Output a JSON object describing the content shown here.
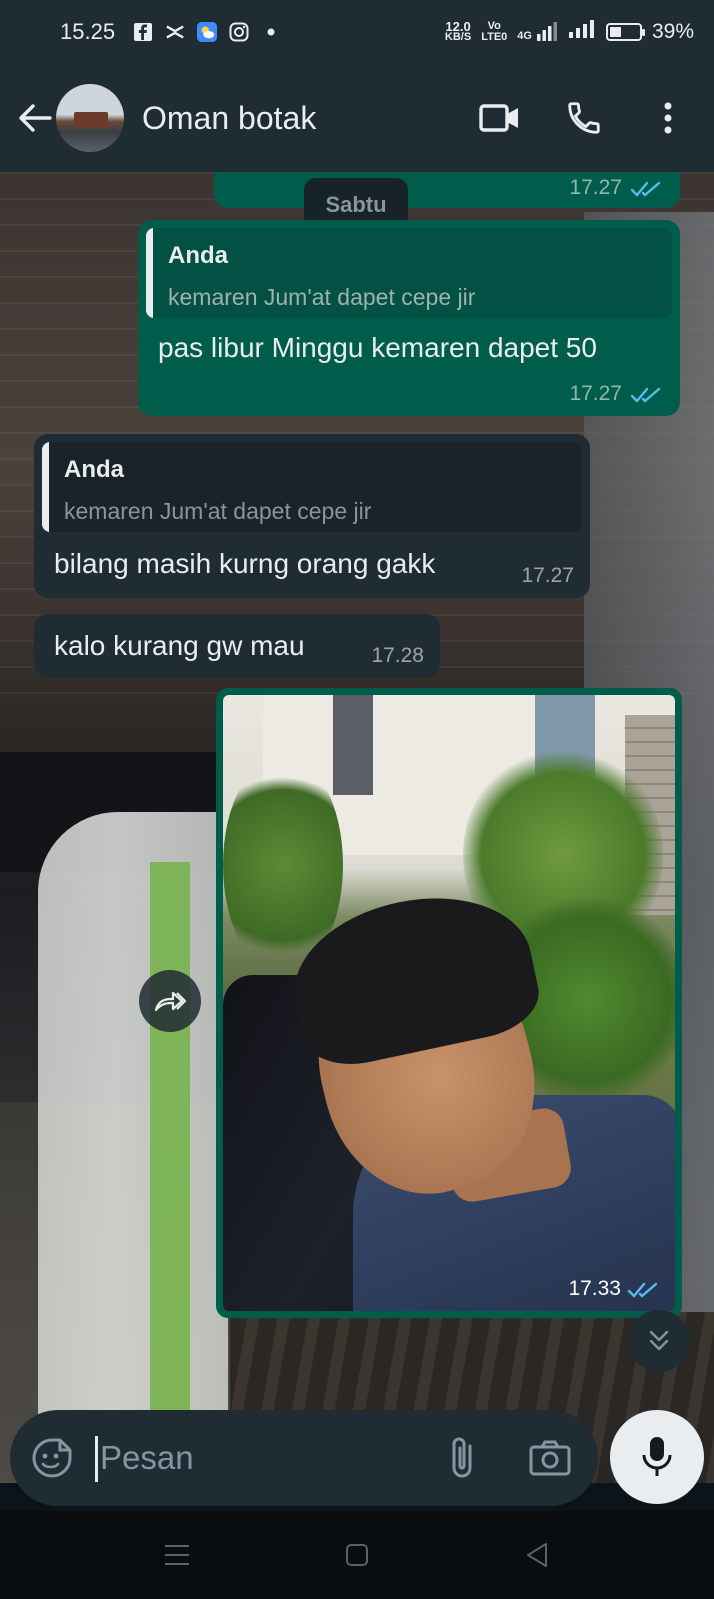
{
  "status_bar": {
    "time": "15.25",
    "net_speed_value": "12.0",
    "net_speed_unit": "KB/S",
    "volte_top": "Vo",
    "volte_bottom": "LTE0",
    "network": "4G",
    "battery": "39%",
    "battery_level": 0.39,
    "icons": [
      "facebook-icon",
      "capcut-icon",
      "weather-icon",
      "instagram-icon",
      "dot-icon"
    ]
  },
  "header": {
    "contact_name": "Oman botak",
    "icons": [
      "back-arrow-icon",
      "avatar",
      "video-call-icon",
      "phone-icon",
      "more-vert-icon"
    ]
  },
  "chat": {
    "date_chip": "Sabtu",
    "messages": [
      {
        "direction": "out",
        "time": "17.27",
        "status": "read"
      },
      {
        "direction": "out",
        "quote_author": "Anda",
        "quote_text": "kemaren Jum'at dapet cepe jir",
        "text": "pas libur Minggu kemaren dapet 50",
        "time": "17.27",
        "status": "read"
      },
      {
        "direction": "in",
        "quote_author": "Anda",
        "quote_text": "kemaren Jum'at dapet cepe jir",
        "text": "bilang masih kurng orang gakk",
        "time": "17.27"
      },
      {
        "direction": "in",
        "text": "kalo kurang gw mau",
        "time": "17.28"
      },
      {
        "direction": "out",
        "type": "image",
        "time": "17.33",
        "status": "read"
      }
    ]
  },
  "composer": {
    "placeholder": "Pesan",
    "value": ""
  },
  "colors": {
    "outgoing_bubble": "#005c4b",
    "incoming_bubble": "#202c33",
    "header_bg": "#1f2c34",
    "read_ticks": "#53bdeb"
  }
}
